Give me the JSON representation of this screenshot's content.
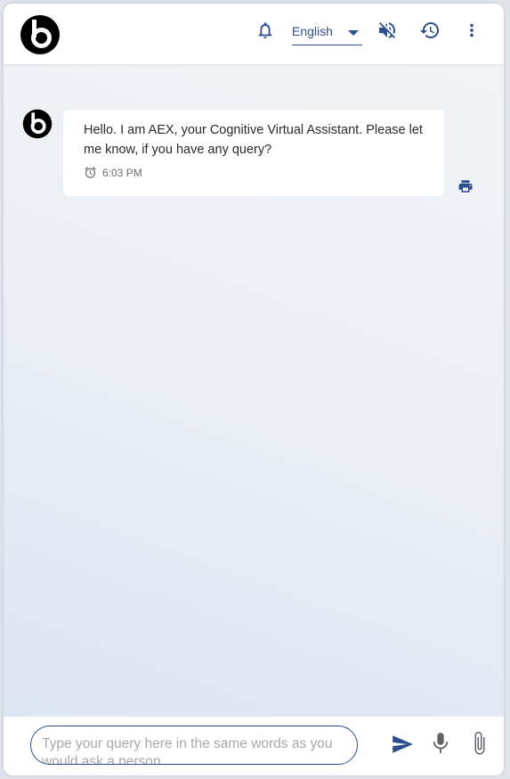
{
  "header": {
    "language": {
      "selected": "English"
    },
    "icons": {
      "logo": "beats-logo-icon",
      "notifications": "bell-icon",
      "mute": "volume-off-icon",
      "history": "history-icon",
      "more": "more-vert-icon"
    }
  },
  "chat": {
    "messages": [
      {
        "sender": "bot",
        "text": "Hello. I am AEX, your Cognitive Virtual Assistant. Please let me know, if you have any query?",
        "time": "6:03 PM"
      }
    ]
  },
  "composer": {
    "placeholder": "Type your query here in the same words as you would ask a person.",
    "value": ""
  },
  "colors": {
    "accent": "#2e4d8c",
    "logo": "#000000",
    "bubble_bg": "#ffffff",
    "text": "#2b2b2b",
    "muted_text": "#6b6b6b",
    "icon_grey": "#5f6368"
  }
}
